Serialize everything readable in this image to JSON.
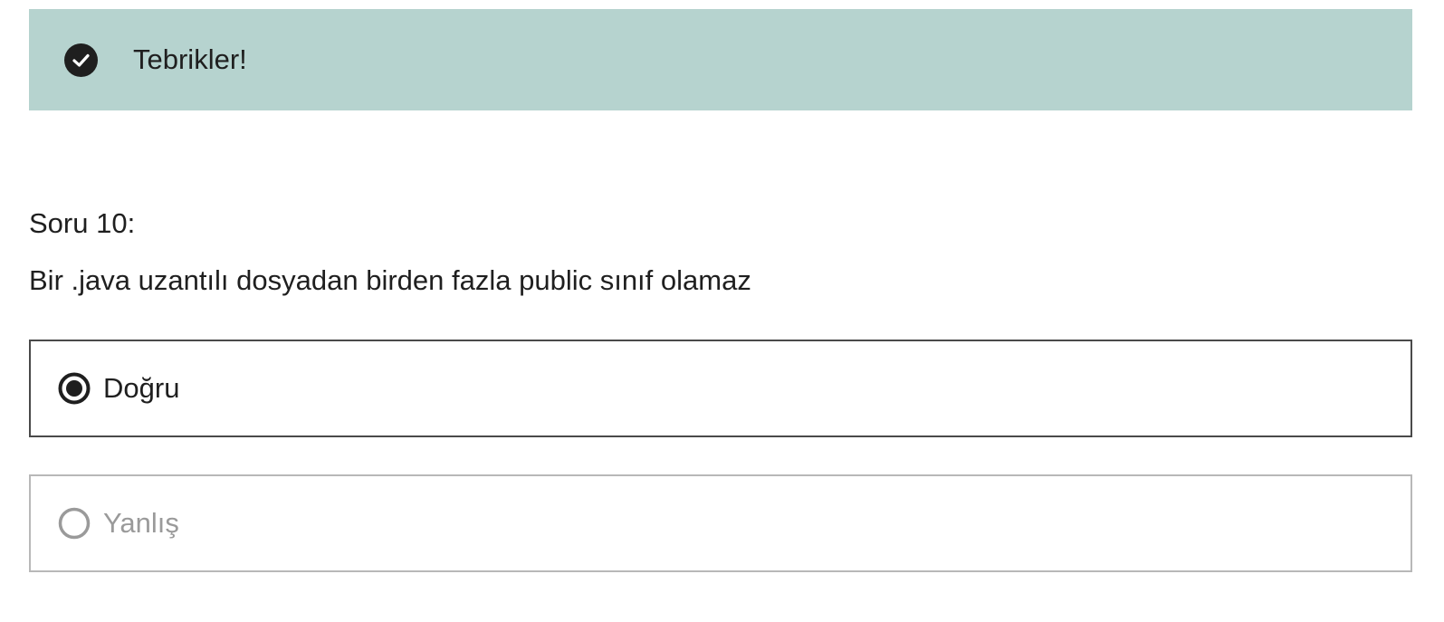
{
  "feedback": {
    "icon": "check-circle-icon",
    "message": "Tebrikler!",
    "background_color": "#b6d3cf"
  },
  "question": {
    "number_label": "Soru 10:",
    "text": "Bir .java uzantılı dosyadan birden fazla public sınıf olamaz"
  },
  "options": [
    {
      "label": "Doğru",
      "selected": true,
      "icon": "radio-checked-icon"
    },
    {
      "label": "Yanlış",
      "selected": false,
      "icon": "radio-unchecked-icon"
    }
  ]
}
